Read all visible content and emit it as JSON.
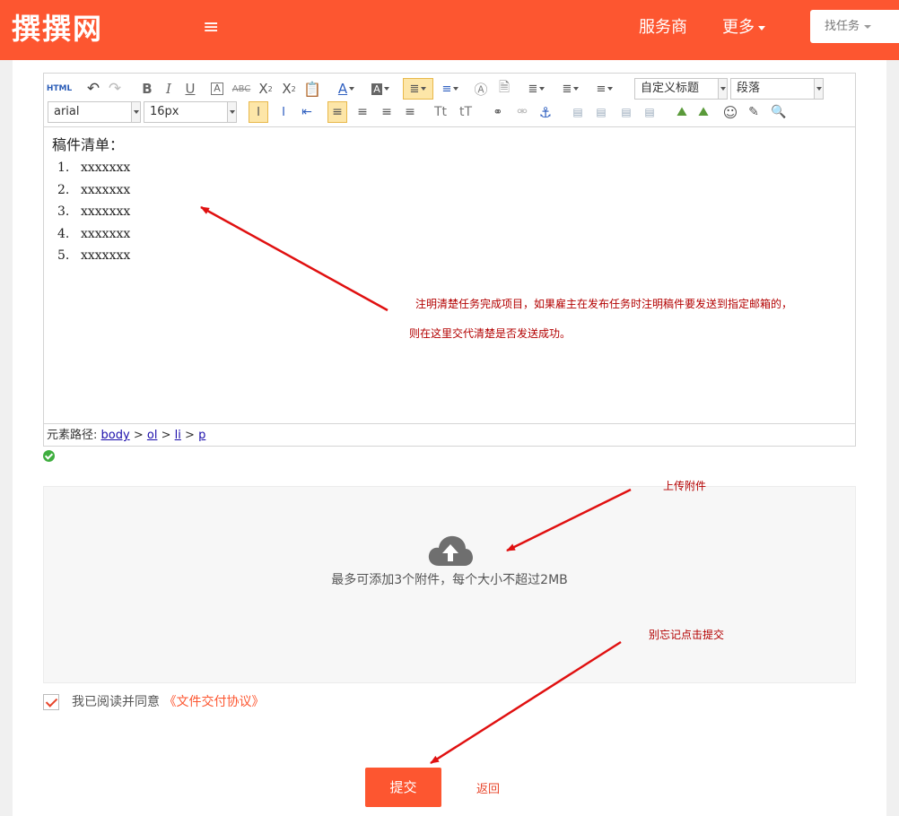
{
  "header": {
    "logo": "撰撰网",
    "menu_icon": "menu-icon",
    "nav": {
      "service": "服务商",
      "more": "更多"
    },
    "find_task": "找任务"
  },
  "editor": {
    "toolbar": {
      "html_label": "HTML",
      "font_family": "arial",
      "font_size": "16px",
      "heading_select": "自定义标题",
      "paragraph_select": "段落"
    },
    "content": {
      "heading": "稿件清单：",
      "items": [
        {
          "num": "1.",
          "text": "xxxxxxx"
        },
        {
          "num": "2.",
          "text": "xxxxxxx"
        },
        {
          "num": "3.",
          "text": "xxxxxxx"
        },
        {
          "num": "4.",
          "text": "xxxxxxx"
        },
        {
          "num": "5.",
          "text": "xxxxxxx"
        }
      ]
    },
    "path": {
      "label": "元素路径:",
      "items": [
        "body",
        "ol",
        "li",
        "p"
      ],
      "separator": ">"
    }
  },
  "upload": {
    "text": "最多可添加3个附件，每个大小不超过2MB",
    "icon": "cloud-upload-icon"
  },
  "agreement": {
    "text": "我已阅读并同意",
    "link": "《文件交付协议》",
    "checked": true
  },
  "actions": {
    "submit": "提交",
    "back": "返回"
  },
  "annotations": {
    "editor_line1": "注明清楚任务完成项目，如果雇主在发布任务时注明稿件要发送到指定邮箱的，",
    "editor_line2": "则在这里交代清楚是否发送成功。",
    "upload": "上传附件",
    "submit": "别忘记点击提交"
  },
  "colors": {
    "brand": "#fd5630",
    "annotation": "#b30000",
    "arrow": "#e01010"
  }
}
